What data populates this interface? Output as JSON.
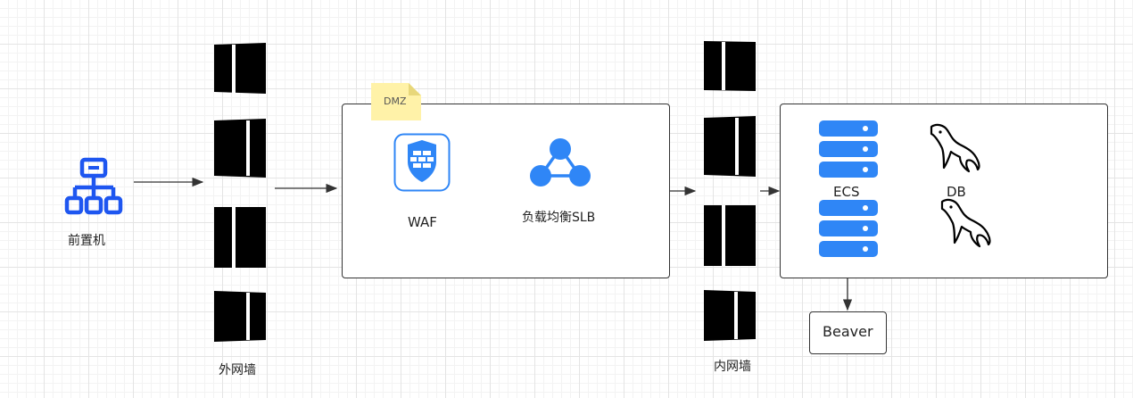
{
  "diagram": {
    "front_machine_label": "前置机",
    "outer_firewall_label": "外网墙",
    "inner_firewall_label": "内网墙",
    "dmz_tag": "DMZ",
    "waf_label": "WAF",
    "slb_label": "负载均衡SLB",
    "ecs_label": "ECS",
    "db_label": "DB",
    "beaver_label": "Beaver"
  },
  "colors": {
    "accent_blue": "#1e6cf0",
    "server_blue": "#2f86f6",
    "note_yellow": "#fff2a8",
    "line": "#333333"
  },
  "icons": [
    "network-tree-icon",
    "firewall-brick-icon",
    "shield-icon",
    "load-balancer-icon",
    "server-stack-icon",
    "mysql-dolphin-icon"
  ]
}
